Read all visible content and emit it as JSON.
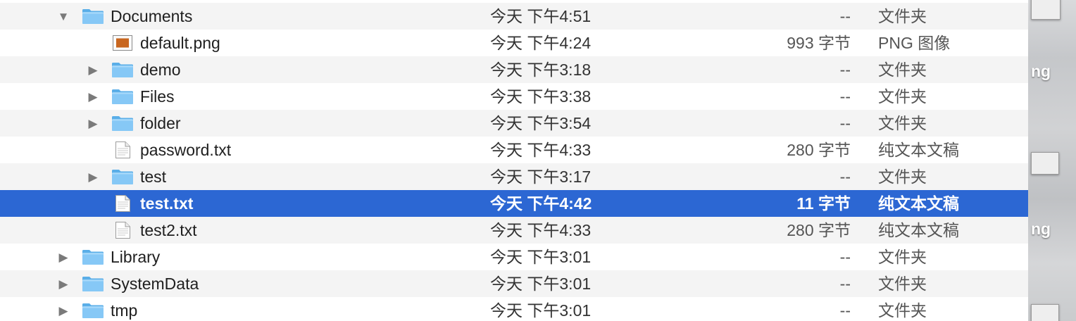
{
  "rows": [
    {
      "name": "Documents",
      "date": "今天 下午4:51",
      "size": "--",
      "kind": "文件夹",
      "icon": "folder-icon",
      "disclosure": "expanded",
      "level": 0
    },
    {
      "name": "default.png",
      "date": "今天 下午4:24",
      "size": "993 字节",
      "kind": "PNG 图像",
      "icon": "image-file-icon",
      "disclosure": "none",
      "level": 1
    },
    {
      "name": "demo",
      "date": "今天 下午3:18",
      "size": "--",
      "kind": "文件夹",
      "icon": "folder-icon",
      "disclosure": "collapsed",
      "level": 1
    },
    {
      "name": "Files",
      "date": "今天 下午3:38",
      "size": "--",
      "kind": "文件夹",
      "icon": "folder-icon",
      "disclosure": "collapsed",
      "level": 1
    },
    {
      "name": "folder",
      "date": "今天 下午3:54",
      "size": "--",
      "kind": "文件夹",
      "icon": "folder-icon",
      "disclosure": "collapsed",
      "level": 1
    },
    {
      "name": "password.txt",
      "date": "今天 下午4:33",
      "size": "280 字节",
      "kind": "纯文本文稿",
      "icon": "text-file-icon",
      "disclosure": "none",
      "level": 1
    },
    {
      "name": "test",
      "date": "今天 下午3:17",
      "size": "--",
      "kind": "文件夹",
      "icon": "folder-icon",
      "disclosure": "collapsed",
      "level": 1
    },
    {
      "name": "test.txt",
      "date": "今天 下午4:42",
      "size": "11 字节",
      "kind": "纯文本文稿",
      "icon": "text-file-icon",
      "disclosure": "none",
      "level": 1,
      "selected": true
    },
    {
      "name": "test2.txt",
      "date": "今天 下午4:33",
      "size": "280 字节",
      "kind": "纯文本文稿",
      "icon": "text-file-icon",
      "disclosure": "none",
      "level": 1
    },
    {
      "name": "Library",
      "date": "今天 下午3:01",
      "size": "--",
      "kind": "文件夹",
      "icon": "folder-icon",
      "disclosure": "collapsed",
      "level": 0
    },
    {
      "name": "SystemData",
      "date": "今天 下午3:01",
      "size": "--",
      "kind": "文件夹",
      "icon": "folder-icon",
      "disclosure": "collapsed",
      "level": 0
    },
    {
      "name": "tmp",
      "date": "今天 下午3:01",
      "size": "--",
      "kind": "文件夹",
      "icon": "folder-icon",
      "disclosure": "collapsed",
      "level": 0
    }
  ],
  "desktop_fragments": [
    "ng",
    "ng"
  ],
  "colors": {
    "selection": "#2c67d3",
    "folder": "#6cb8f0",
    "row_alt": "#f4f4f4"
  }
}
